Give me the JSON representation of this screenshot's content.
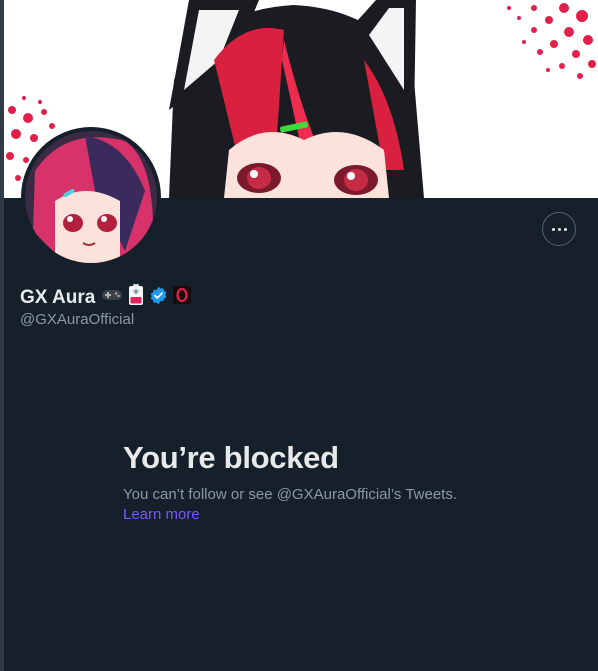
{
  "profile": {
    "display_name": "GX Aura",
    "handle": "@GXAuraOfficial",
    "badges": [
      "gamepad-emoji",
      "battery-emoji",
      "verified-badge",
      "opera-gx-logo"
    ]
  },
  "actions": {
    "more_label": "More"
  },
  "blocked": {
    "title": "You’re blocked",
    "description": "You can’t follow or see @GXAuraOfficial’s Tweets.",
    "learn_more": "Learn more"
  },
  "colors": {
    "background": "#15202b",
    "text_primary": "#e7e9ea",
    "text_secondary": "#8b98a5",
    "link": "#7856ff",
    "verified": "#1d9bf0",
    "accent_red": "#e4204a"
  }
}
